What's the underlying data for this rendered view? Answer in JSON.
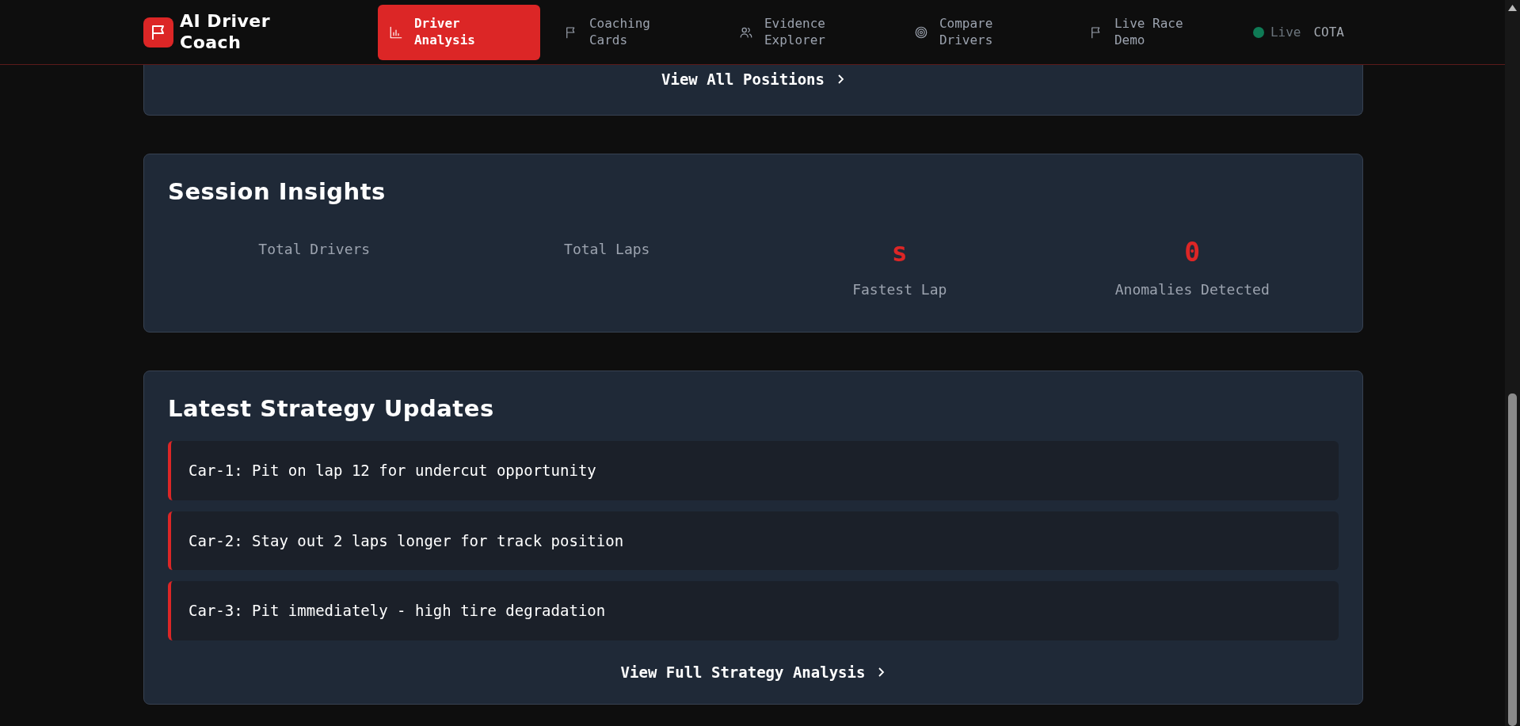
{
  "brand": {
    "name": "AI Driver Coach"
  },
  "nav": [
    {
      "label": "Driver Analysis",
      "selected": true
    },
    {
      "label": "Coaching Cards",
      "selected": false
    },
    {
      "label": "Evidence Explorer",
      "selected": false
    },
    {
      "label": "Compare Drivers",
      "selected": false
    },
    {
      "label": "Live Race Demo",
      "selected": false
    }
  ],
  "status": {
    "live": true,
    "label": "Live",
    "track": "COTA"
  },
  "positions": {
    "link": "View All Positions"
  },
  "insights": {
    "title": "Session Insights",
    "stats": [
      {
        "label": "Total Drivers"
      },
      {
        "label": "Total Laps"
      },
      {
        "value": "s",
        "label": "Fastest Lap"
      },
      {
        "value": "0",
        "label": "Anomalies Detected"
      }
    ]
  },
  "strategy": {
    "title": "Latest Strategy Updates",
    "updates": [
      "Car-1: Pit on lap 12 for undercut opportunity",
      "Car-2: Stay out 2 laps longer for track position",
      "Car-3: Pit immediately - high tire degradation"
    ],
    "link": "View Full Strategy Analysis"
  }
}
